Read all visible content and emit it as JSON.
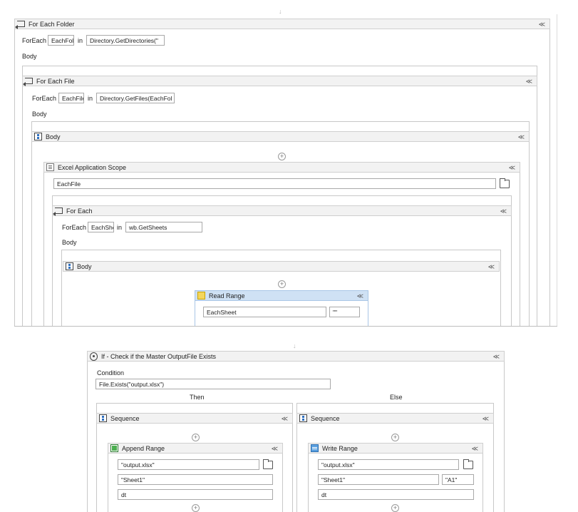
{
  "top": {
    "for_each_folder": {
      "title": "For Each Folder",
      "foreach_label": "ForEach",
      "item_var": "EachFolc",
      "in_label": "in",
      "collection": "Directory.GetDirectories(\"",
      "body_label": "Body"
    },
    "for_each_file": {
      "title": "For Each File",
      "foreach_label": "ForEach",
      "item_var": "EachFile",
      "in_label": "in",
      "collection": "Directory.GetFiles(EachFol",
      "body_label": "Body"
    },
    "body_sequence": {
      "title": "Body"
    },
    "excel_scope": {
      "title": "Excel Application Scope",
      "path_value": "EachFile"
    },
    "for_each": {
      "title": "For Each",
      "foreach_label": "ForEach",
      "item_var": "EachShe",
      "in_label": "in",
      "collection": "wb.GetSheets",
      "body_label": "Body"
    },
    "inner_body": {
      "title": "Body"
    },
    "read_range": {
      "title": "Read Range",
      "sheet_value": "EachSheet",
      "range_value": "\"\""
    }
  },
  "bottom": {
    "if_activity": {
      "title": "If - Check if the Master OutputFile Exists",
      "condition_label": "Condition",
      "condition_value": "File.Exists(\"output.xlsx\")",
      "then_label": "Then",
      "else_label": "Else"
    },
    "then_sequence": {
      "title": "Sequence",
      "append_range": {
        "title": "Append Range",
        "file_value": "\"output.xlsx\"",
        "sheet_value": "\"Sheet1\"",
        "datatable_value": "dt"
      }
    },
    "else_sequence": {
      "title": "Sequence",
      "write_range": {
        "title": "Write Range",
        "file_value": "\"output.xlsx\"",
        "sheet_value": "\"Sheet1\"",
        "cell_value": "\"A1\"",
        "datatable_value": "dt"
      }
    }
  },
  "glyphs": {
    "collapse": "≪",
    "plus": "+",
    "down_arrow": "↓"
  },
  "colors": {
    "header_bg": "#f2f2f2",
    "selected_header_bg": "#cfe1f4",
    "border": "#c8c8c8"
  }
}
